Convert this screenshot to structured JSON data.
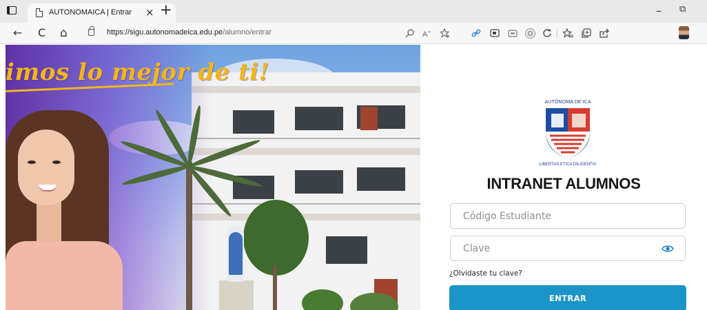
{
  "browser": {
    "tab_title": "AUTONOMAICA | Entrar",
    "tab_close": "×",
    "new_tab": "+",
    "minimize": "–",
    "restore": "⧉",
    "url_host": "https://sigu.autonomadeica.edu.pe",
    "url_path": "/alumno/entrar",
    "nav": {
      "back": "←",
      "refresh": "C",
      "home": "⌂"
    },
    "toolbar_icons": [
      "search-icon",
      "read-aloud-icon",
      "favorite-add-icon",
      "extension-red-icon",
      "link-icon",
      "screen-icon",
      "wallet-icon",
      "ring-icon",
      "refresh-extension-icon",
      "favorites-icon",
      "collections-icon",
      "share-icon",
      "profile-icon"
    ]
  },
  "hero": {
    "slogan": "imos lo mejor de ti!",
    "colors": {
      "overlay": "#5f28a0",
      "slogan": "#f3b51c"
    }
  },
  "login": {
    "logo_text": "AUTÓNOMA DE ICA",
    "logo_motto": "LIBERTAS ETICA DILIGENTIA",
    "heading": "INTRANET ALUMNOS",
    "code_placeholder": "Código Estudiante",
    "password_placeholder": "Clave",
    "forgot": "¿Olvidaste tu clave?",
    "submit": "ENTRAR",
    "accent_color": "#1b95c8"
  }
}
